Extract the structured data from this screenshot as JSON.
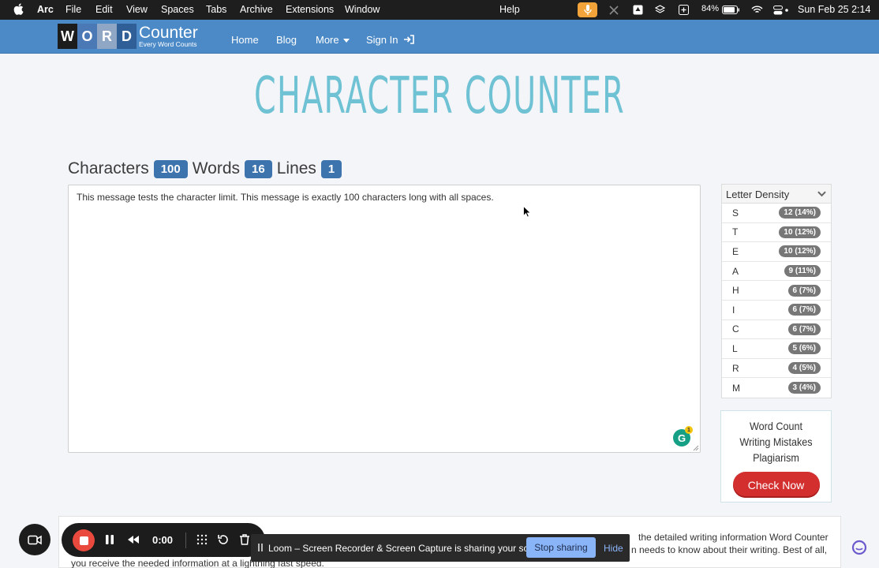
{
  "menubar": {
    "app": "Arc",
    "items": [
      "File",
      "Edit",
      "View",
      "Spaces",
      "Tabs",
      "Archive",
      "Extensions",
      "Window"
    ],
    "help": "Help",
    "battery": "84%",
    "datetime": "Sun Feb 25  2:14"
  },
  "nav": {
    "logo_letters": [
      "W",
      "O",
      "R",
      "D"
    ],
    "logo_word": "Counter",
    "logo_tagline": "Every Word Counts",
    "home": "Home",
    "blog": "Blog",
    "more": "More",
    "signin": "Sign In"
  },
  "page": {
    "title": "CHARACTER COUNTER"
  },
  "counts": {
    "characters_label": "Characters",
    "characters": "100",
    "words_label": "Words",
    "words": "16",
    "lines_label": "Lines",
    "lines": "1"
  },
  "editor": {
    "text": "This message tests the character limit. This message is exactly 100 characters long with all spaces.",
    "grammarly_badge": "1"
  },
  "density": {
    "title": "Letter Density",
    "rows": [
      {
        "letter": "S",
        "value": "12 (14%)"
      },
      {
        "letter": "T",
        "value": "10 (12%)"
      },
      {
        "letter": "E",
        "value": "10 (12%)"
      },
      {
        "letter": "A",
        "value": "9 (11%)"
      },
      {
        "letter": "H",
        "value": "6 (7%)"
      },
      {
        "letter": "I",
        "value": "6 (7%)"
      },
      {
        "letter": "C",
        "value": "6 (7%)"
      },
      {
        "letter": "L",
        "value": "5 (6%)"
      },
      {
        "letter": "R",
        "value": "4 (5%)"
      },
      {
        "letter": "M",
        "value": "3 (4%)"
      }
    ]
  },
  "ad": {
    "line1": "Word Count",
    "line2": "Writing Mistakes",
    "line3": "Plagiarism",
    "button": "Check Now"
  },
  "about": {
    "line1": "the detailed writing information Word Counter",
    "line2": "n needs to know about their writing. Best of all,",
    "line3": "you receive the needed information at a lightning fast speed."
  },
  "loom": {
    "timer": "0:00",
    "share_message": "Loom – Screen Recorder & Screen Capture is sharing your screen.",
    "stop_sharing": "Stop sharing",
    "hide": "Hide"
  },
  "colors": {
    "navbar": "#4c8ac7",
    "title": "#6fc2d3",
    "badge": "#3d74ad",
    "check_now": "#d32f2f"
  }
}
